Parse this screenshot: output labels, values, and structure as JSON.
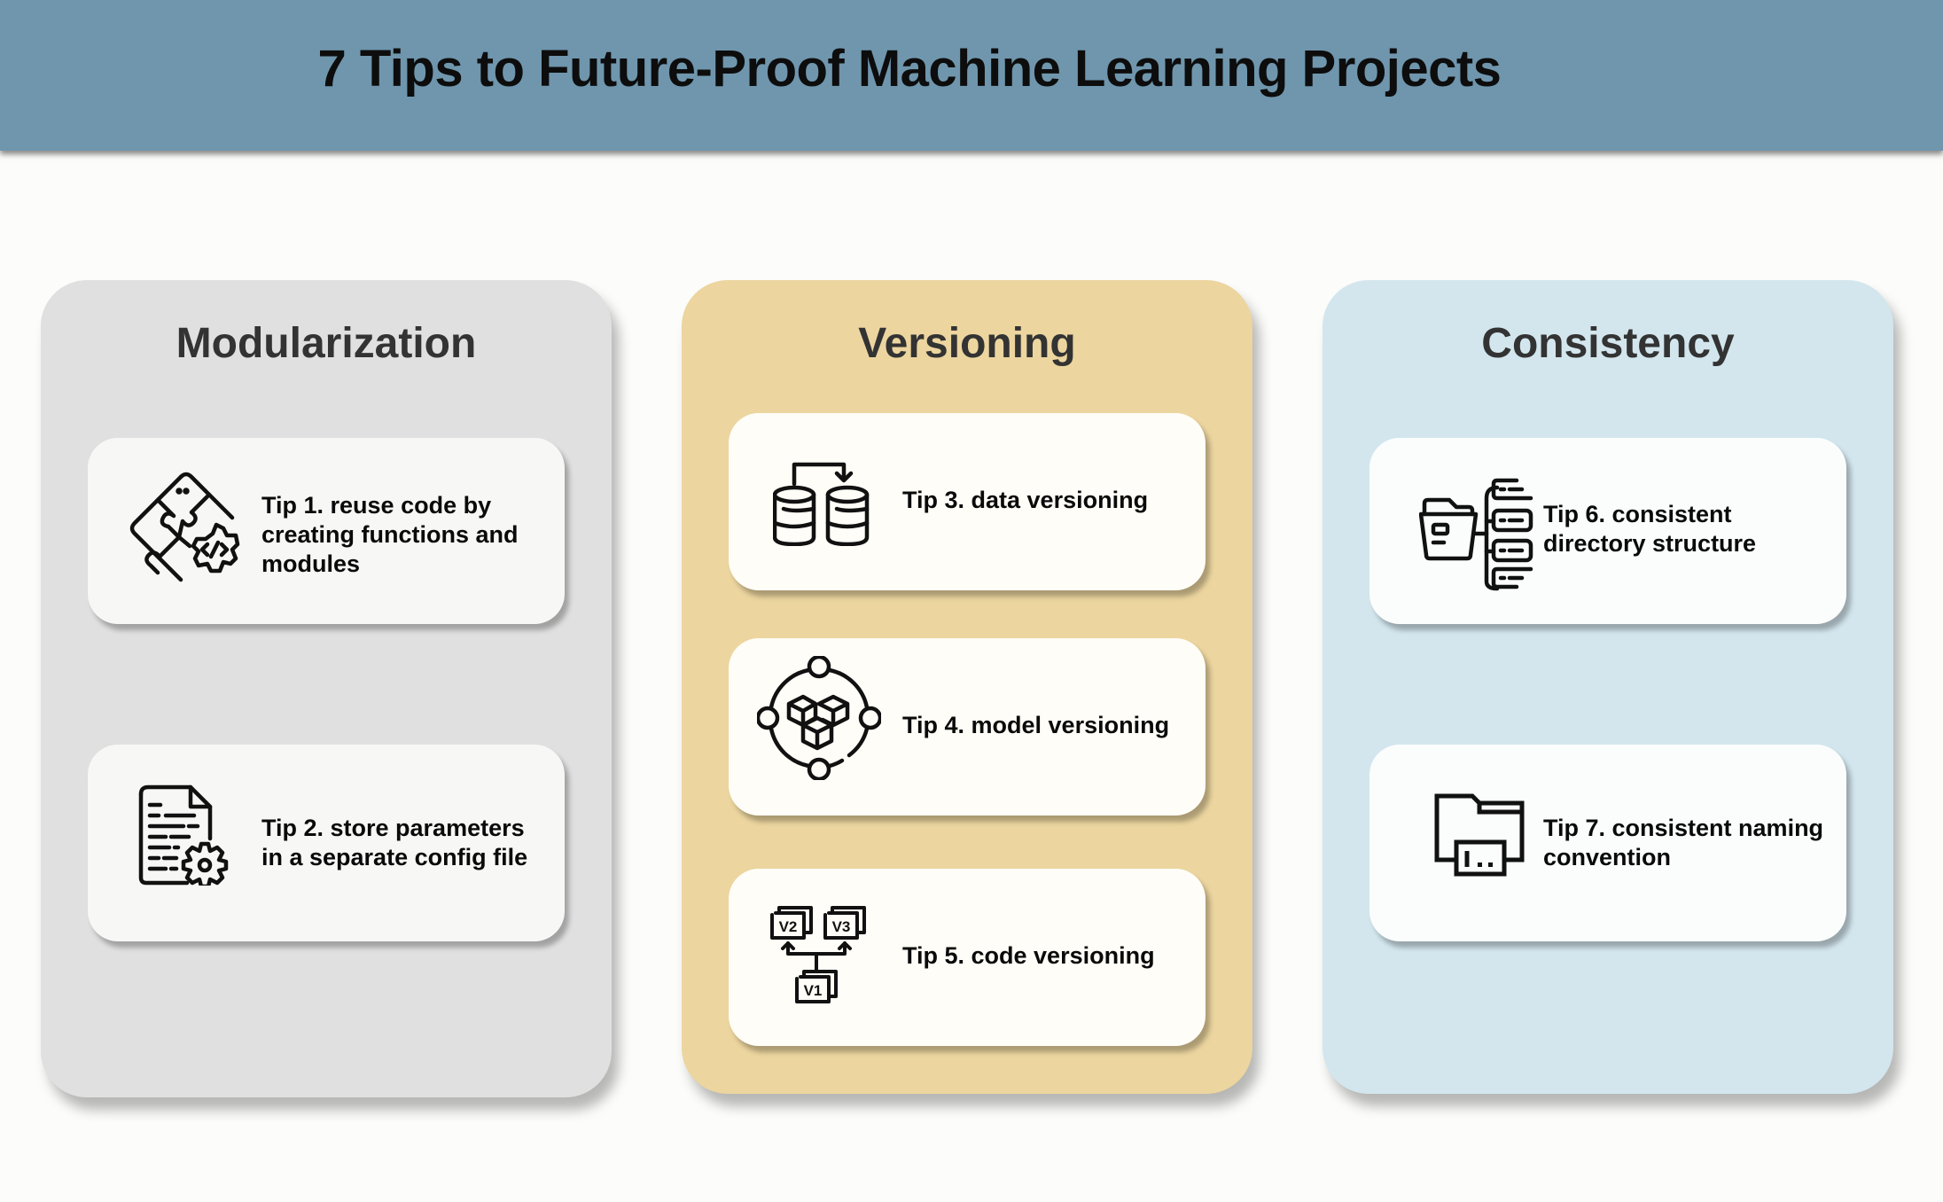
{
  "title": "7 Tips to Future-Proof Machine Learning Projects",
  "colors": {
    "banner": "#6f96ad",
    "background": "#fcfcfa",
    "modularization": "#e0e0e0",
    "versioning": "#ecd59f",
    "consistency": "#d3e6ee",
    "heading_text": "#333333",
    "body_text": "#0a0a0a"
  },
  "columns": [
    {
      "heading": "Modularization",
      "tips": [
        {
          "icon": "puzzle-code-icon",
          "text": "Tip 1. reuse code by creating functions and modules"
        },
        {
          "icon": "config-file-gear-icon",
          "text": "Tip 2. store parameters in a separate config file"
        }
      ]
    },
    {
      "heading": "Versioning",
      "tips": [
        {
          "icon": "database-copy-icon",
          "text": "Tip 3. data versioning"
        },
        {
          "icon": "model-cubes-orbit-icon",
          "text": "Tip 4. model versioning"
        },
        {
          "icon": "code-versions-icon",
          "text": "Tip 5. code versioning",
          "icon_labels": [
            "V2",
            "V3",
            "V1"
          ]
        }
      ]
    },
    {
      "heading": "Consistency",
      "tips": [
        {
          "icon": "folder-tree-icon",
          "text": "Tip 6. consistent directory structure"
        },
        {
          "icon": "folder-naming-icon",
          "text": "Tip 7. consistent naming convention"
        }
      ]
    }
  ]
}
